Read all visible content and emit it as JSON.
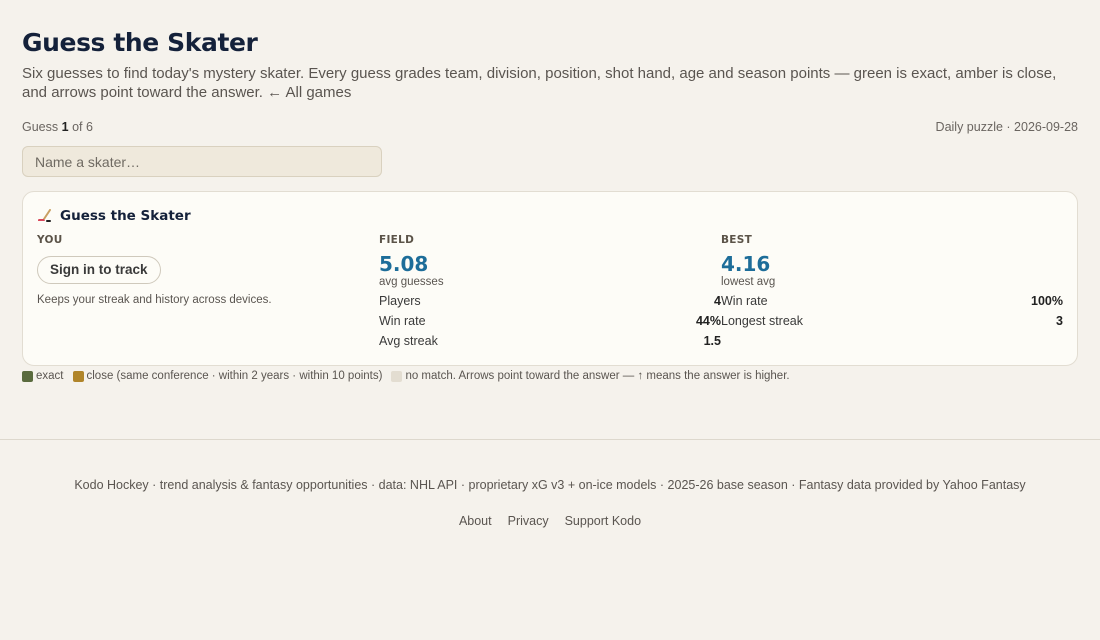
{
  "page": {
    "title": "Guess the Skater",
    "intro": "Six guesses to find today's mystery skater. Every guess grades team, division, position, shot hand, age and season points — green is exact, amber is close, and arrows point toward the answer.",
    "back_link": "← All games"
  },
  "status": {
    "guess_prefix": "Guess",
    "guess_current": "1",
    "guess_suffix": "of 6",
    "daily": "Daily puzzle · 2026-09-28"
  },
  "search": {
    "placeholder": "Name a skater…",
    "value": ""
  },
  "card": {
    "icon": "hockey-stick-icon",
    "title": "Guess the Skater",
    "you": {
      "heading": "YOU",
      "button": "Sign in to track",
      "note": "Keeps your streak and history across devices."
    },
    "field": {
      "heading": "FIELD",
      "value": "5.08",
      "label": "avg guesses",
      "stats": [
        {
          "label": "Players",
          "value": "4"
        },
        {
          "label": "Win rate",
          "value": "44%"
        },
        {
          "label": "Avg streak",
          "value": "1.5"
        }
      ]
    },
    "best": {
      "heading": "BEST",
      "value": "4.16",
      "label": "lowest avg",
      "stats": [
        {
          "label": "Win rate",
          "value": "100%"
        },
        {
          "label": "Longest streak",
          "value": "3"
        }
      ]
    }
  },
  "legend": {
    "exact": "exact",
    "close": "close (same conference · within 2 years · within 10 points)",
    "none": "no match. Arrows point toward the answer — ↑ means the answer is higher.",
    "colors": {
      "exact": "#5a6b3e",
      "close": "#b0852a",
      "none": "#e3ddd1"
    }
  },
  "footer": {
    "credits": "Kodo Hockey · trend analysis & fantasy opportunities · data: NHL API · proprietary xG v3 + on-ice models · 2025-26 base season · Fantasy data provided by Yahoo Fantasy",
    "links": [
      "About",
      "Privacy",
      "Support Kodo"
    ]
  }
}
